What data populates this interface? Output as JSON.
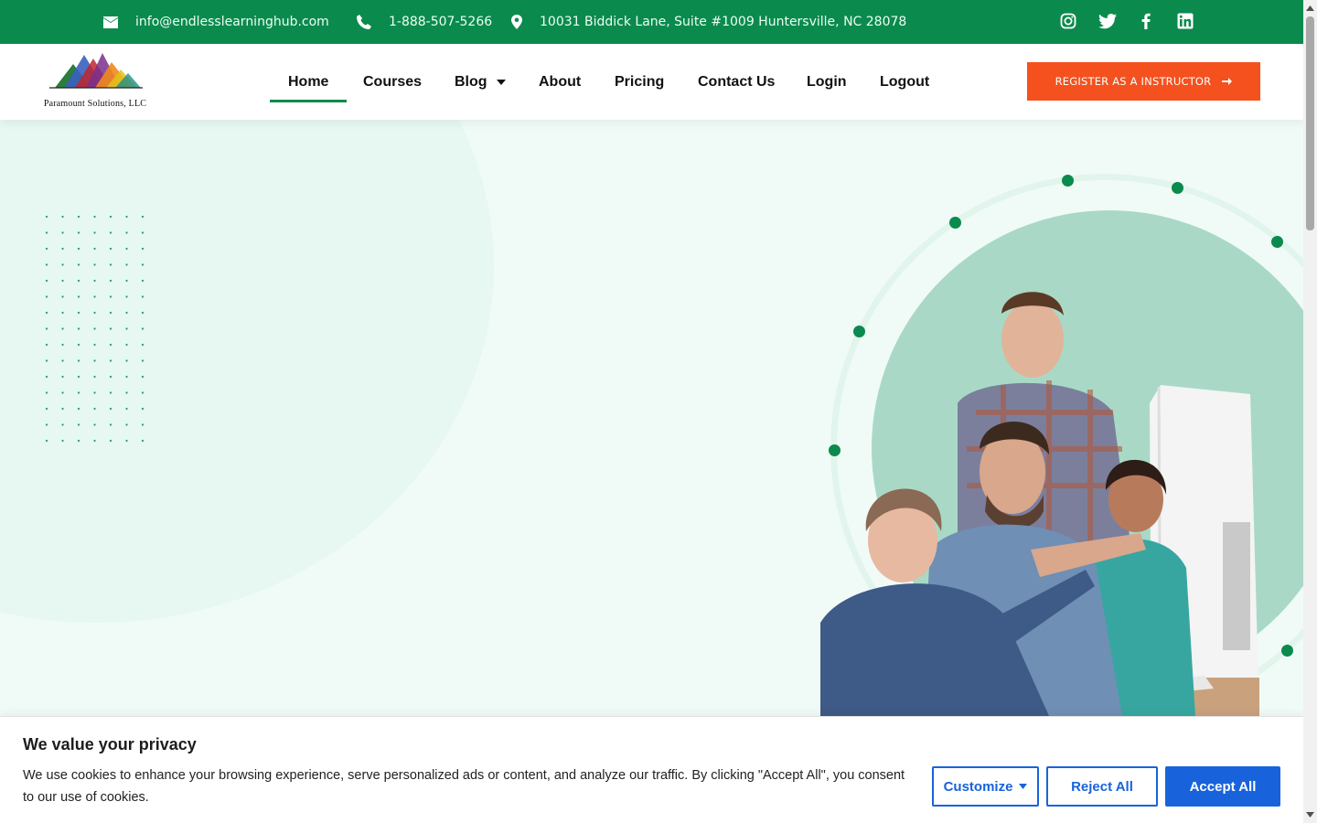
{
  "topbar": {
    "email": "info@endlesslearninghub.com",
    "phone": "1-888-507-5266",
    "address": "10031 Biddick Lane, Suite #1009 Huntersville, NC 28078",
    "social_icons": [
      "instagram-icon",
      "twitter-icon",
      "facebook-icon",
      "linkedin-icon"
    ]
  },
  "header": {
    "logo_text": "Paramount Solutions, LLC",
    "nav": {
      "home": "Home",
      "courses": "Courses",
      "blog": "Blog",
      "about": "About",
      "pricing": "Pricing",
      "contact": "Contact Us",
      "login": "Login",
      "logout": "Logout"
    },
    "active_nav": "Home",
    "register_button": "REGISTER AS A INSTRUCTOR"
  },
  "cookie_banner": {
    "title": "We value your privacy",
    "text": "We use cookies to enhance your browsing experience, serve personalized ads or content, and analyze our traffic. By clicking \"Accept All\", you consent to our use of cookies.",
    "customize": "Customize",
    "reject": "Reject All",
    "accept": "Accept All"
  },
  "colors": {
    "brand_green": "#0b8a4d",
    "cta_orange": "#f4511e",
    "cookie_blue": "#1863dc"
  }
}
